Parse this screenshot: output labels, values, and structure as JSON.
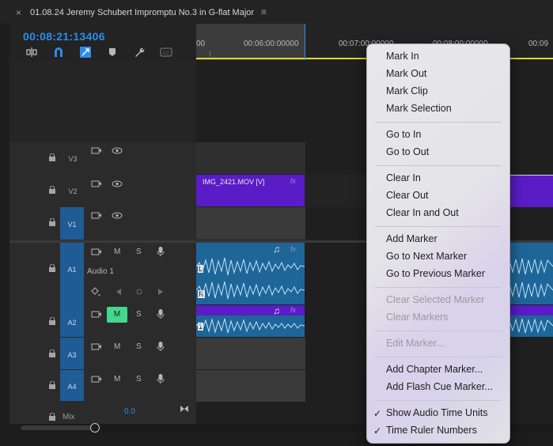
{
  "tab": {
    "close": "×",
    "title": "01.08.24 Jeremy Schubert Impromptu No.3 in G-flat Major",
    "menu": "≡"
  },
  "timecode": "00:08:21:13406",
  "ruler": {
    "labels": [
      "00",
      "00:06:00:00000",
      "00:07:00:00000",
      "00:08:00:00000",
      "00:09"
    ]
  },
  "tracks": {
    "v3": "V3",
    "v2": "V2",
    "v1": "V1",
    "a1": "A1",
    "a1_name": "Audio 1",
    "a2": "A2",
    "a3": "A3",
    "a4": "A4",
    "mute": "M",
    "solo": "S",
    "mix": "Mix",
    "mix_value": "0.0"
  },
  "clips": {
    "video_name": "IMG_2421.MOV [V]",
    "fx": "fx",
    "ch_l": "L",
    "ch_r": "R",
    "ch_1": "1"
  },
  "context_menu": {
    "items": [
      {
        "label": "Mark In",
        "enabled": true
      },
      {
        "label": "Mark Out",
        "enabled": true
      },
      {
        "label": "Mark Clip",
        "enabled": true
      },
      {
        "label": "Mark Selection",
        "enabled": true
      },
      {
        "label": "Go to In",
        "enabled": true
      },
      {
        "label": "Go to Out",
        "enabled": true
      },
      {
        "label": "Clear In",
        "enabled": true
      },
      {
        "label": "Clear Out",
        "enabled": true
      },
      {
        "label": "Clear In and Out",
        "enabled": true
      },
      {
        "label": "Add Marker",
        "enabled": true
      },
      {
        "label": "Go to Next Marker",
        "enabled": true
      },
      {
        "label": "Go to Previous Marker",
        "enabled": true
      },
      {
        "label": "Clear Selected Marker",
        "enabled": false
      },
      {
        "label": "Clear Markers",
        "enabled": false
      },
      {
        "label": "Edit Marker...",
        "enabled": false
      },
      {
        "label": "Add Chapter Marker...",
        "enabled": true
      },
      {
        "label": "Add Flash Cue Marker...",
        "enabled": true
      },
      {
        "label": "Show Audio Time Units",
        "enabled": true,
        "checked": true
      },
      {
        "label": "Time Ruler Numbers",
        "enabled": true,
        "checked": true
      }
    ],
    "check_glyph": "✓"
  },
  "colors": {
    "accent": "#2d8ceb",
    "video_clip": "#5a1cc7",
    "audio_clip": "#1f6698",
    "mute_on": "#43d88c",
    "work_area": "#e7d62c"
  }
}
